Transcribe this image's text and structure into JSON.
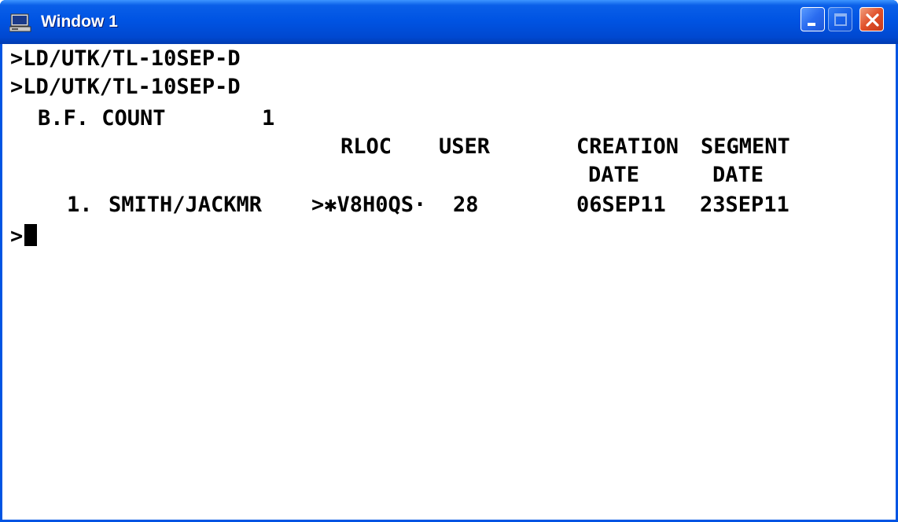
{
  "window": {
    "title": "Window 1",
    "icon": "computer-icon",
    "controls": [
      "minimize-icon",
      "maximize-icon",
      "close-icon"
    ]
  },
  "terminal": {
    "command_1": ">LD/UTK/TL-10SEP-D",
    "command_2": ">LD/UTK/TL-10SEP-D",
    "bf_count_label": "B.F. COUNT",
    "bf_count_value": "1",
    "headers": {
      "rloc": "RLOC",
      "user": "USER",
      "creation": "CREATION",
      "creation_sub": "DATE",
      "segment": "SEGMENT",
      "segment_sub": "DATE"
    },
    "rows": [
      {
        "index": "1.",
        "name": "SMITH/JACKMR",
        "rloc": ">✱V8H0QS·",
        "user": "28",
        "creation_date": "06SEP11",
        "segment_date": "23SEP11"
      }
    ],
    "prompt": ">"
  },
  "colors": {
    "titlebar": "#0054e3",
    "close_button": "#e0502a",
    "terminal_bg": "#ffffff",
    "terminal_text": "#000000"
  }
}
